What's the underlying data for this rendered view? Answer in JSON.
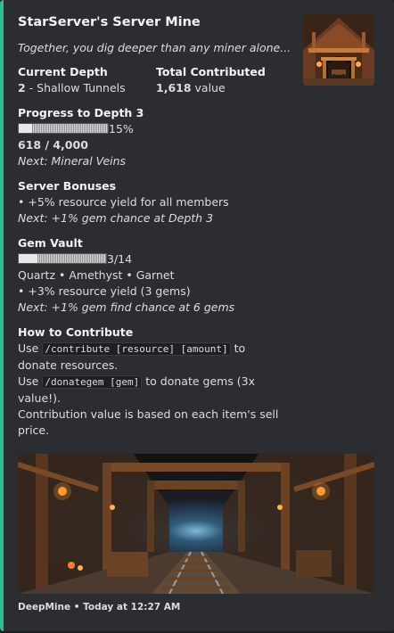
{
  "embed": {
    "accent_color": "#2fbf8f",
    "title": "StarServer's Server Mine",
    "description": "Together, you dig deeper than any miner alone...",
    "fields": {
      "current_depth": {
        "name": "Current Depth",
        "value_bold": "2",
        "value_rest": " - Shallow Tunnels"
      },
      "total_contributed": {
        "name": "Total Contributed",
        "value_bold": "1,618",
        "value_rest": " value"
      },
      "progress": {
        "name": "Progress to Depth 3",
        "percent_label": "15%",
        "fraction": 0.15,
        "amount": "618 / 4,000",
        "next": "Next: Mineral Veins"
      },
      "bonuses": {
        "name": "Server Bonuses",
        "line1": "• +5% resource yield for all members",
        "next": "Next: +1% gem chance at Depth 3"
      },
      "gem_vault": {
        "name": "Gem Vault",
        "count_label": "3/14",
        "fraction": 0.2143,
        "gems": "Quartz • Amethyst • Garnet",
        "bonus": "• +3% resource yield (3 gems)",
        "next": "Next: +1% gem find chance at 6 gems"
      },
      "how_to": {
        "name": "How to Contribute",
        "use1": "Use ",
        "cmd1": "/contribute [resource] [amount]",
        "after1": " to",
        "line2": "donate resources.",
        "use2": "Use ",
        "cmd2": "/donategem [gem]",
        "after2": " to donate gems (3x",
        "line4": "value!).",
        "line5": "Contribution value is based on each item's sell",
        "line6": "price."
      }
    },
    "footer": {
      "author": "DeepMine",
      "separator": " • ",
      "timestamp": "Today at 12:27 AM"
    },
    "thumbnail": {
      "icon": "mine-entrance-icon"
    },
    "image": {
      "icon": "mine-tunnel-image"
    }
  }
}
